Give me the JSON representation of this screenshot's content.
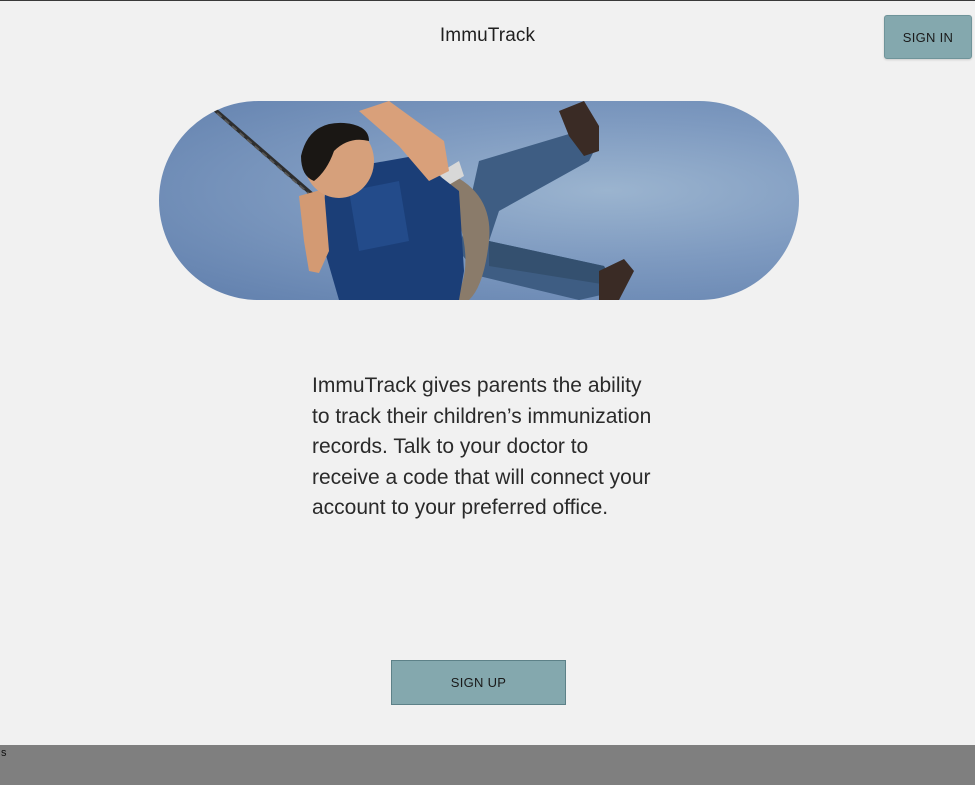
{
  "header": {
    "title": "ImmuTrack",
    "sign_in_label": "SIGN IN"
  },
  "hero": {
    "image_icon": "child-on-swing-photo"
  },
  "main": {
    "description": "ImmuTrack gives parents the ability to track their children’s immunization records. Talk to your doctor to receive a code that will connect your account to your preferred office.",
    "sign_up_label": "SIGN UP"
  },
  "status_bar": {
    "text": "s"
  },
  "colors": {
    "background": "#f1f1f1",
    "button": "#84a8ae",
    "status_bar": "#7f7f7f"
  }
}
